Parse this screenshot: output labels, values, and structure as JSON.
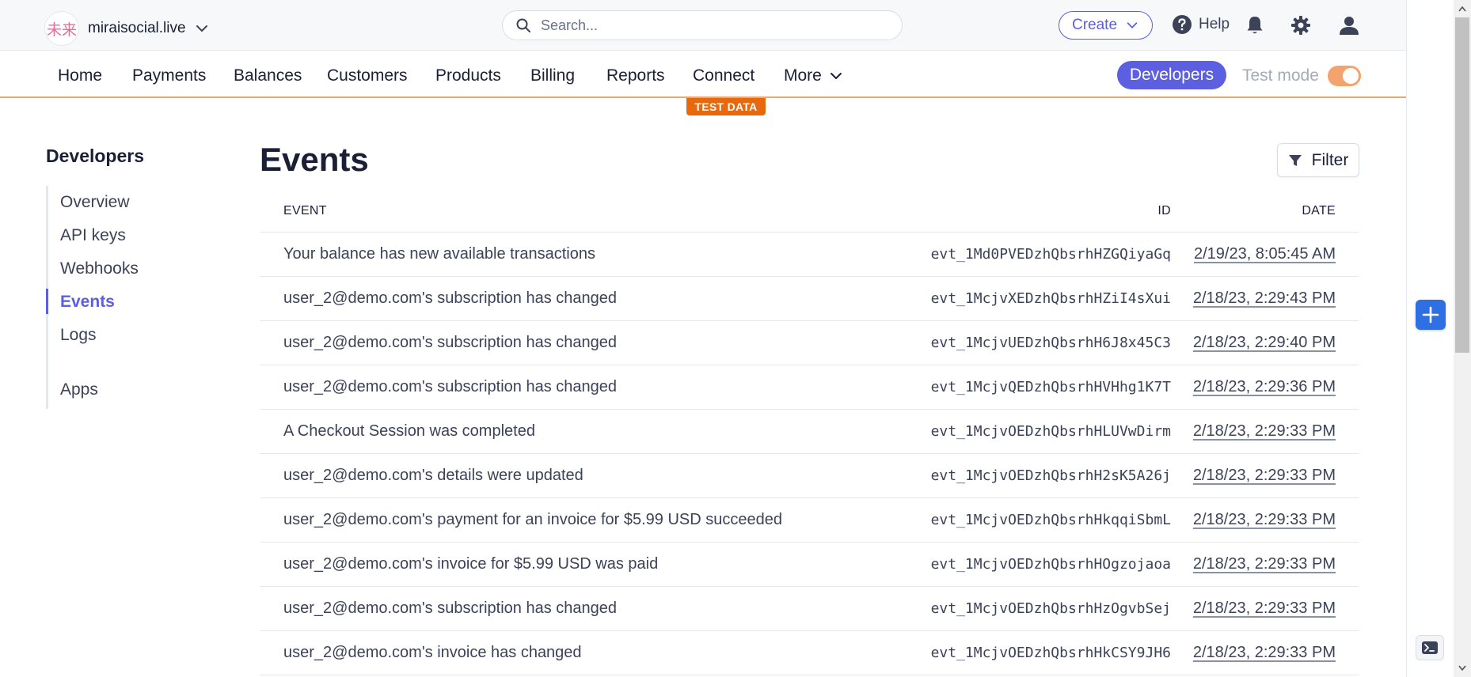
{
  "topbar": {
    "brand_logo_text": "未来",
    "account_name": "miraisocial.live",
    "search_placeholder": "Search...",
    "create_label": "Create",
    "help_label": "Help"
  },
  "nav": {
    "items": [
      "Home",
      "Payments",
      "Balances",
      "Customers",
      "Products",
      "Billing",
      "Reports",
      "Connect"
    ],
    "more_label": "More",
    "developers_label": "Developers",
    "test_mode_label": "Test mode",
    "test_mode_on": true,
    "test_data_badge": "TEST DATA"
  },
  "sidebar": {
    "title": "Developers",
    "items": [
      "Overview",
      "API keys",
      "Webhooks",
      "Events",
      "Logs",
      "Apps"
    ],
    "active": "Events"
  },
  "main": {
    "title": "Events",
    "filter_label": "Filter",
    "columns": {
      "event": "EVENT",
      "id": "ID",
      "date": "DATE"
    },
    "rows": [
      {
        "event": "Your balance has new available transactions",
        "id": "evt_1Md0PVEDzhQbsrhHZGQiyaGq",
        "date": "2/19/23, 8:05:45 AM"
      },
      {
        "event": "user_2@demo.com's subscription has changed",
        "id": "evt_1McjvXEDzhQbsrhHZiI4sXui",
        "date": "2/18/23, 2:29:43 PM"
      },
      {
        "event": "user_2@demo.com's subscription has changed",
        "id": "evt_1McjvUEDzhQbsrhH6J8x45C3",
        "date": "2/18/23, 2:29:40 PM"
      },
      {
        "event": "user_2@demo.com's subscription has changed",
        "id": "evt_1McjvQEDzhQbsrhHVHhg1K7T",
        "date": "2/18/23, 2:29:36 PM"
      },
      {
        "event": "A Checkout Session was completed",
        "id": "evt_1McjvOEDzhQbsrhHLUVwDirm",
        "date": "2/18/23, 2:29:33 PM"
      },
      {
        "event": "user_2@demo.com's details were updated",
        "id": "evt_1McjvOEDzhQbsrhH2sK5A26j",
        "date": "2/18/23, 2:29:33 PM"
      },
      {
        "event": "user_2@demo.com's payment for an invoice for $5.99 USD succeeded",
        "id": "evt_1McjvOEDzhQbsrhHkqqiSbmL",
        "date": "2/18/23, 2:29:33 PM"
      },
      {
        "event": "user_2@demo.com's invoice for $5.99 USD was paid",
        "id": "evt_1McjvOEDzhQbsrhHOgzojaoa",
        "date": "2/18/23, 2:29:33 PM"
      },
      {
        "event": "user_2@demo.com's subscription has changed",
        "id": "evt_1McjvOEDzhQbsrhHzOgvbSej",
        "date": "2/18/23, 2:29:33 PM"
      },
      {
        "event": "user_2@demo.com's invoice has changed",
        "id": "evt_1McjvOEDzhQbsrhHkCSY9JH6",
        "date": "2/18/23, 2:29:33 PM"
      }
    ]
  },
  "colors": {
    "accent": "#5b5fe0",
    "test_mode": "#e8680d",
    "toggle": "#f5a36c",
    "floating_button": "#2f6fe4"
  },
  "icons": {
    "search": "search-icon",
    "chevron": "chevron-down-icon",
    "help": "help-icon",
    "bell": "bell-icon",
    "settings": "gear-icon",
    "user": "user-icon",
    "filter": "filter-icon",
    "plus": "plus-icon",
    "terminal": "terminal-icon"
  }
}
